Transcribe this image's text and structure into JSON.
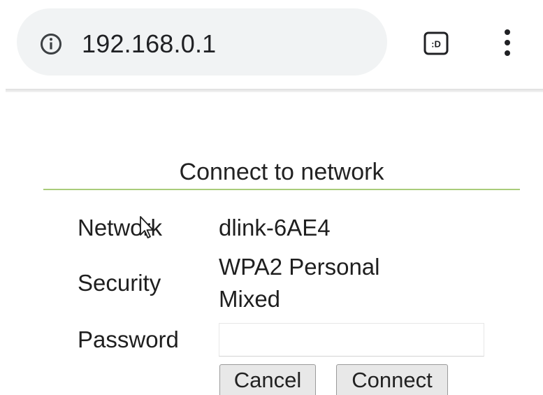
{
  "browser": {
    "url": "192.168.0.1",
    "tab_switcher_label": ":D",
    "icons": {
      "info": "info-icon",
      "tabs": "tab-switcher-icon",
      "menu": "more-vert-icon"
    }
  },
  "form": {
    "title": "Connect to network",
    "rows": {
      "network": {
        "label": "Network",
        "value": "dlink-6AE4"
      },
      "security": {
        "label": "Security",
        "value_line1": "WPA2 Personal",
        "value_line2": "Mixed"
      },
      "password": {
        "label": "Password",
        "value": ""
      }
    },
    "buttons": {
      "cancel": "Cancel",
      "connect": "Connect"
    }
  },
  "colors": {
    "urlbar_bg": "#f1f3f4",
    "title_rule": "#a9cc7a",
    "button_bg": "#e8e8e8"
  }
}
